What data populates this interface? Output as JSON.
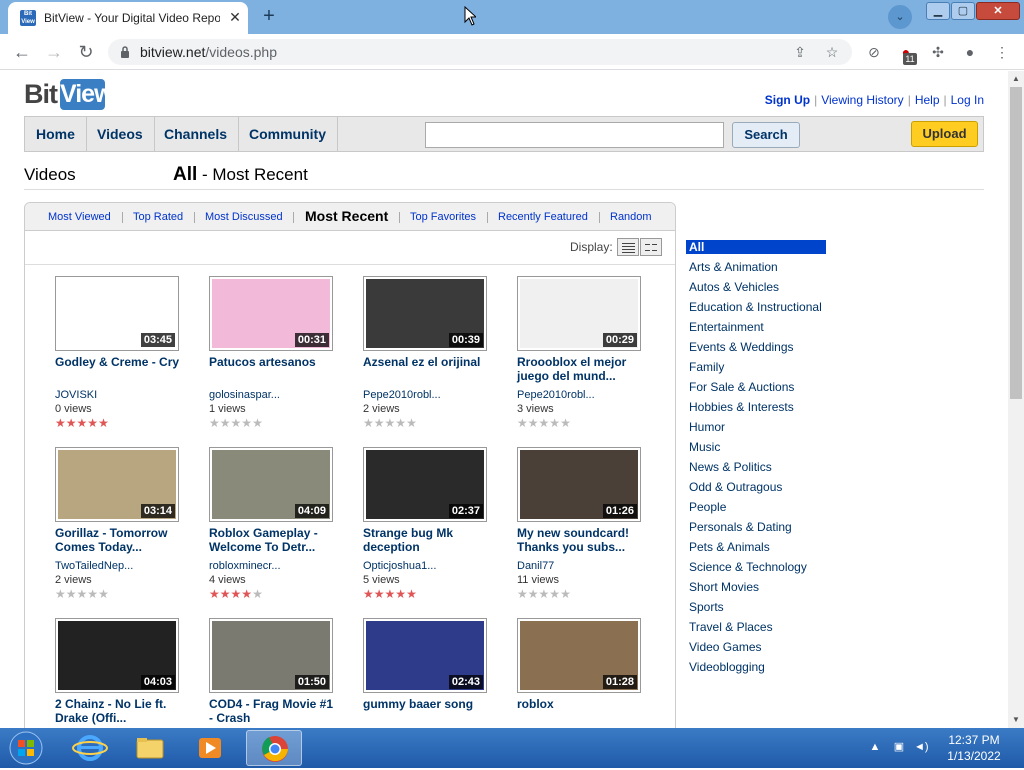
{
  "browser": {
    "tab_title": "BitView - Your Digital Video Repository",
    "url_host": "bitview.net",
    "url_path": "/videos.php",
    "extension_badge": "11"
  },
  "site": {
    "logo_bit": "Bit",
    "logo_view": "View",
    "user_links": [
      "Sign Up",
      "Viewing History",
      "Help",
      "Log In"
    ],
    "nav": [
      "Home",
      "Videos",
      "Channels",
      "Community"
    ],
    "search_button": "Search",
    "upload_button": "Upload",
    "search_value": ""
  },
  "page": {
    "heading": "Videos",
    "sub_bold": "All",
    "sub_rest": " - Most Recent",
    "sort_tabs": [
      "Most Viewed",
      "Top Rated",
      "Most Discussed",
      "Most Recent",
      "Top Favorites",
      "Recently Featured",
      "Random"
    ],
    "active_sort": "Most Recent",
    "display_label": "Display:"
  },
  "videos": [
    {
      "title": "Godley & Creme - Cry",
      "user": "JOVISKI",
      "views": "0 views",
      "duration": "03:45",
      "rating": 5
    },
    {
      "title": "Patucos artesanos",
      "user": "golosinaspar...",
      "views": "1 views",
      "duration": "00:31",
      "rating": 0
    },
    {
      "title": "Azsenal ez el orijinal",
      "user": "Pepe2010robl...",
      "views": "2 views",
      "duration": "00:39",
      "rating": 0
    },
    {
      "title": "Rroooblox el mejor juego del mund...",
      "user": "Pepe2010robl...",
      "views": "3 views",
      "duration": "00:29",
      "rating": 0
    },
    {
      "title": "Gorillaz - Tomorrow Comes Today...",
      "user": "TwoTailedNep...",
      "views": "2 views",
      "duration": "03:14",
      "rating": 0
    },
    {
      "title": "Roblox Gameplay - Welcome To Detr...",
      "user": "robloxminecr...",
      "views": "4 views",
      "duration": "04:09",
      "rating": 4
    },
    {
      "title": "Strange bug Mk deception",
      "user": "Opticjoshua1...",
      "views": "5 views",
      "duration": "02:37",
      "rating": 5
    },
    {
      "title": "My new soundcard! Thanks you subs...",
      "user": "Danil77",
      "views": "11 views",
      "duration": "01:26",
      "rating": 0
    },
    {
      "title": "2 Chainz - No Lie ft. Drake (Offi...",
      "user": "",
      "views": "",
      "duration": "04:03",
      "rating": 0
    },
    {
      "title": "COD4 - Frag Movie #1 - Crash",
      "user": "",
      "views": "",
      "duration": "01:50",
      "rating": 0
    },
    {
      "title": "gummy baaer song",
      "user": "",
      "views": "",
      "duration": "02:43",
      "rating": 0
    },
    {
      "title": "roblox",
      "user": "",
      "views": "",
      "duration": "01:28",
      "rating": 0
    }
  ],
  "categories": [
    "All",
    "Arts & Animation",
    "Autos & Vehicles",
    "Education & Instructional",
    "Entertainment",
    "Events & Weddings",
    "Family",
    "For Sale & Auctions",
    "Hobbies & Interests",
    "Humor",
    "Music",
    "News & Politics",
    "Odd & Outragous",
    "People",
    "Personals & Dating",
    "Pets & Animals",
    "Science & Technology",
    "Short Movies",
    "Sports",
    "Travel & Places",
    "Video Games",
    "Videoblogging"
  ],
  "selected_category": "All",
  "taskbar": {
    "time": "12:37 PM",
    "date": "1/13/2022"
  },
  "colors": {
    "link": "#003366",
    "selected_category_bg": "#0044cc",
    "upload_button": "#ffcc22",
    "star_on": "#e05555",
    "tabstrip": "#7eb0e0"
  }
}
